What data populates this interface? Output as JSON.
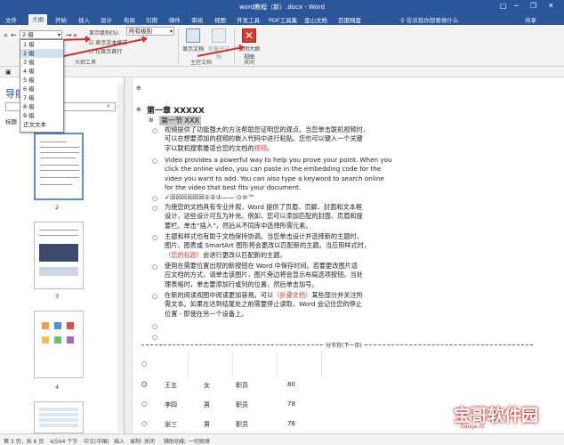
{
  "title": "word教程（新）.docx - Word",
  "window_controls": {
    "restore": "□",
    "minimize": "─",
    "maximize": "❐",
    "close": "✕"
  },
  "tabs": [
    "文件",
    "大纲",
    "开始",
    "插入",
    "设计",
    "布局",
    "引用",
    "邮件",
    "审阅",
    "视图",
    "开发工具",
    "PDF工具集",
    "金山文档",
    "百度网盘"
  ],
  "active_tab": "大纲",
  "tellme": "♀ 告诉我你想要做什么",
  "share": "共享",
  "ribbon": {
    "level_combo": "2 级",
    "show_level_label": "显示级别(S):",
    "show_level_value": "所有级别",
    "show_text_format": "显示文本格式",
    "show_first_line": "仅显示首行",
    "outline_tools": "大纲工具",
    "show_doc": "显示文档",
    "collapse_sub": "折叠子文档",
    "master_doc": "主控文档",
    "close_outline": "关闭大纲视图",
    "close_group": "关闭"
  },
  "level_options": [
    "1 级",
    "2 级",
    "3 级",
    "4 级",
    "5 级",
    "6 级",
    "7 级",
    "8 级",
    "9 级",
    "正文文本"
  ],
  "nav": {
    "title": "导航",
    "tab": "标题",
    "pages": [
      "2",
      "3",
      "4"
    ]
  },
  "doc": {
    "h1": "第一章 XXXXX",
    "h2": "第一节 XXX",
    "para1": [
      "视频提供了功能强大的方法帮助您证明您的观点。当您单击联机视频时，",
      "可以在想要添加的视频的嵌入代码中进行粘贴。您也可以键入一个关键",
      "字以联机搜索最适合您的文档的"
    ],
    "para1_red": "视频",
    "para1_end": "。",
    "para2": [
      "Video provides a powerful way to help you prove your point. When you",
      "click the online video, you can paste in the embedding code for the",
      "video you want to add. You can also type a keyword to search online",
      "for the video that best fits your document."
    ],
    "para3": "✓☒☒☒☒☒☒①②③——        ⊙℗™",
    "para4": [
      "为使您的文档具有专业外观，Word 提供了页眉、页脚、封面和文本框",
      "设计，这些设计可互为补充。例如，您可以添加匹配的封面、页眉和提",
      "要栏。单击“插入”，然后从不同库中选择所需元素。"
    ],
    "para5": [
      "主题和样式也有助于文档保持协调。当您单击设计并选择新的主题时，",
      "图片、图表或 SmartArt 图形将会更改以匹配新的主题。当应用样式时，"
    ],
    "para5_red": "（您的标题）",
    "para5_end": "会进行更改以匹配新的主题。",
    "para6": [
      "使用在需要位置出现的新按钮在 Word 中保存时间。若要更改图片适",
      "应文档的方式，请单击该图片，图片旁边将会显示布局选项按钮。当处",
      "理表格时，单击要添加行或列的位置，然后单击加号。"
    ],
    "para7_a": "在新的阅读视图中阅读更加容易。可以",
    "para7_red": "（折叠文档）",
    "para7_b": "某些部分并关注所",
    "para7_rest": [
      "需文本。如果在达到结尾处之前需要停止读取，Word 会记住您的停止",
      "位置 - 即使在另一个设备上。"
    ],
    "section_break": "分节符(下一页)",
    "table": [
      [
        "王五",
        "女",
        "职员",
        "80"
      ],
      [
        "李四",
        "男",
        "职员",
        "78"
      ],
      [
        "张三",
        "男",
        "职员",
        "76"
      ]
    ]
  },
  "status": {
    "page": "第 3 页，共 6 页",
    "words": "4/544 个字",
    "lang": "中文(中国)",
    "insert": "插入",
    "macro": "录制: 关闭",
    "acc": "辅助功能: 一切就绪"
  },
  "watermark": {
    "main": "宝哥软件园",
    "sub": "baoge.cc"
  }
}
